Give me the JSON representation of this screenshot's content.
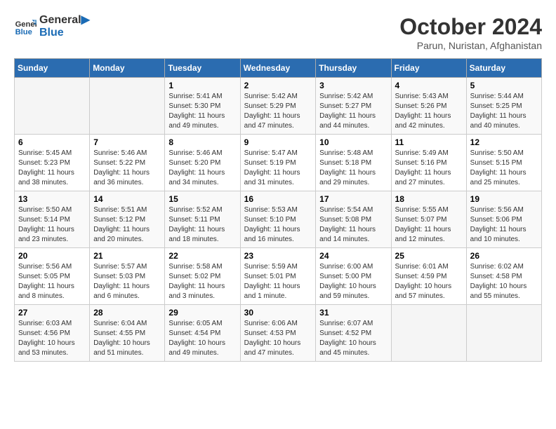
{
  "header": {
    "logo_line1": "General",
    "logo_line2": "Blue",
    "month": "October 2024",
    "location": "Parun, Nuristan, Afghanistan"
  },
  "days_of_week": [
    "Sunday",
    "Monday",
    "Tuesday",
    "Wednesday",
    "Thursday",
    "Friday",
    "Saturday"
  ],
  "weeks": [
    [
      {
        "day": "",
        "sunrise": "",
        "sunset": "",
        "daylight": ""
      },
      {
        "day": "",
        "sunrise": "",
        "sunset": "",
        "daylight": ""
      },
      {
        "day": "1",
        "sunrise": "Sunrise: 5:41 AM",
        "sunset": "Sunset: 5:30 PM",
        "daylight": "Daylight: 11 hours and 49 minutes."
      },
      {
        "day": "2",
        "sunrise": "Sunrise: 5:42 AM",
        "sunset": "Sunset: 5:29 PM",
        "daylight": "Daylight: 11 hours and 47 minutes."
      },
      {
        "day": "3",
        "sunrise": "Sunrise: 5:42 AM",
        "sunset": "Sunset: 5:27 PM",
        "daylight": "Daylight: 11 hours and 44 minutes."
      },
      {
        "day": "4",
        "sunrise": "Sunrise: 5:43 AM",
        "sunset": "Sunset: 5:26 PM",
        "daylight": "Daylight: 11 hours and 42 minutes."
      },
      {
        "day": "5",
        "sunrise": "Sunrise: 5:44 AM",
        "sunset": "Sunset: 5:25 PM",
        "daylight": "Daylight: 11 hours and 40 minutes."
      }
    ],
    [
      {
        "day": "6",
        "sunrise": "Sunrise: 5:45 AM",
        "sunset": "Sunset: 5:23 PM",
        "daylight": "Daylight: 11 hours and 38 minutes."
      },
      {
        "day": "7",
        "sunrise": "Sunrise: 5:46 AM",
        "sunset": "Sunset: 5:22 PM",
        "daylight": "Daylight: 11 hours and 36 minutes."
      },
      {
        "day": "8",
        "sunrise": "Sunrise: 5:46 AM",
        "sunset": "Sunset: 5:20 PM",
        "daylight": "Daylight: 11 hours and 34 minutes."
      },
      {
        "day": "9",
        "sunrise": "Sunrise: 5:47 AM",
        "sunset": "Sunset: 5:19 PM",
        "daylight": "Daylight: 11 hours and 31 minutes."
      },
      {
        "day": "10",
        "sunrise": "Sunrise: 5:48 AM",
        "sunset": "Sunset: 5:18 PM",
        "daylight": "Daylight: 11 hours and 29 minutes."
      },
      {
        "day": "11",
        "sunrise": "Sunrise: 5:49 AM",
        "sunset": "Sunset: 5:16 PM",
        "daylight": "Daylight: 11 hours and 27 minutes."
      },
      {
        "day": "12",
        "sunrise": "Sunrise: 5:50 AM",
        "sunset": "Sunset: 5:15 PM",
        "daylight": "Daylight: 11 hours and 25 minutes."
      }
    ],
    [
      {
        "day": "13",
        "sunrise": "Sunrise: 5:50 AM",
        "sunset": "Sunset: 5:14 PM",
        "daylight": "Daylight: 11 hours and 23 minutes."
      },
      {
        "day": "14",
        "sunrise": "Sunrise: 5:51 AM",
        "sunset": "Sunset: 5:12 PM",
        "daylight": "Daylight: 11 hours and 20 minutes."
      },
      {
        "day": "15",
        "sunrise": "Sunrise: 5:52 AM",
        "sunset": "Sunset: 5:11 PM",
        "daylight": "Daylight: 11 hours and 18 minutes."
      },
      {
        "day": "16",
        "sunrise": "Sunrise: 5:53 AM",
        "sunset": "Sunset: 5:10 PM",
        "daylight": "Daylight: 11 hours and 16 minutes."
      },
      {
        "day": "17",
        "sunrise": "Sunrise: 5:54 AM",
        "sunset": "Sunset: 5:08 PM",
        "daylight": "Daylight: 11 hours and 14 minutes."
      },
      {
        "day": "18",
        "sunrise": "Sunrise: 5:55 AM",
        "sunset": "Sunset: 5:07 PM",
        "daylight": "Daylight: 11 hours and 12 minutes."
      },
      {
        "day": "19",
        "sunrise": "Sunrise: 5:56 AM",
        "sunset": "Sunset: 5:06 PM",
        "daylight": "Daylight: 11 hours and 10 minutes."
      }
    ],
    [
      {
        "day": "20",
        "sunrise": "Sunrise: 5:56 AM",
        "sunset": "Sunset: 5:05 PM",
        "daylight": "Daylight: 11 hours and 8 minutes."
      },
      {
        "day": "21",
        "sunrise": "Sunrise: 5:57 AM",
        "sunset": "Sunset: 5:03 PM",
        "daylight": "Daylight: 11 hours and 6 minutes."
      },
      {
        "day": "22",
        "sunrise": "Sunrise: 5:58 AM",
        "sunset": "Sunset: 5:02 PM",
        "daylight": "Daylight: 11 hours and 3 minutes."
      },
      {
        "day": "23",
        "sunrise": "Sunrise: 5:59 AM",
        "sunset": "Sunset: 5:01 PM",
        "daylight": "Daylight: 11 hours and 1 minute."
      },
      {
        "day": "24",
        "sunrise": "Sunrise: 6:00 AM",
        "sunset": "Sunset: 5:00 PM",
        "daylight": "Daylight: 10 hours and 59 minutes."
      },
      {
        "day": "25",
        "sunrise": "Sunrise: 6:01 AM",
        "sunset": "Sunset: 4:59 PM",
        "daylight": "Daylight: 10 hours and 57 minutes."
      },
      {
        "day": "26",
        "sunrise": "Sunrise: 6:02 AM",
        "sunset": "Sunset: 4:58 PM",
        "daylight": "Daylight: 10 hours and 55 minutes."
      }
    ],
    [
      {
        "day": "27",
        "sunrise": "Sunrise: 6:03 AM",
        "sunset": "Sunset: 4:56 PM",
        "daylight": "Daylight: 10 hours and 53 minutes."
      },
      {
        "day": "28",
        "sunrise": "Sunrise: 6:04 AM",
        "sunset": "Sunset: 4:55 PM",
        "daylight": "Daylight: 10 hours and 51 minutes."
      },
      {
        "day": "29",
        "sunrise": "Sunrise: 6:05 AM",
        "sunset": "Sunset: 4:54 PM",
        "daylight": "Daylight: 10 hours and 49 minutes."
      },
      {
        "day": "30",
        "sunrise": "Sunrise: 6:06 AM",
        "sunset": "Sunset: 4:53 PM",
        "daylight": "Daylight: 10 hours and 47 minutes."
      },
      {
        "day": "31",
        "sunrise": "Sunrise: 6:07 AM",
        "sunset": "Sunset: 4:52 PM",
        "daylight": "Daylight: 10 hours and 45 minutes."
      },
      {
        "day": "",
        "sunrise": "",
        "sunset": "",
        "daylight": ""
      },
      {
        "day": "",
        "sunrise": "",
        "sunset": "",
        "daylight": ""
      }
    ]
  ]
}
